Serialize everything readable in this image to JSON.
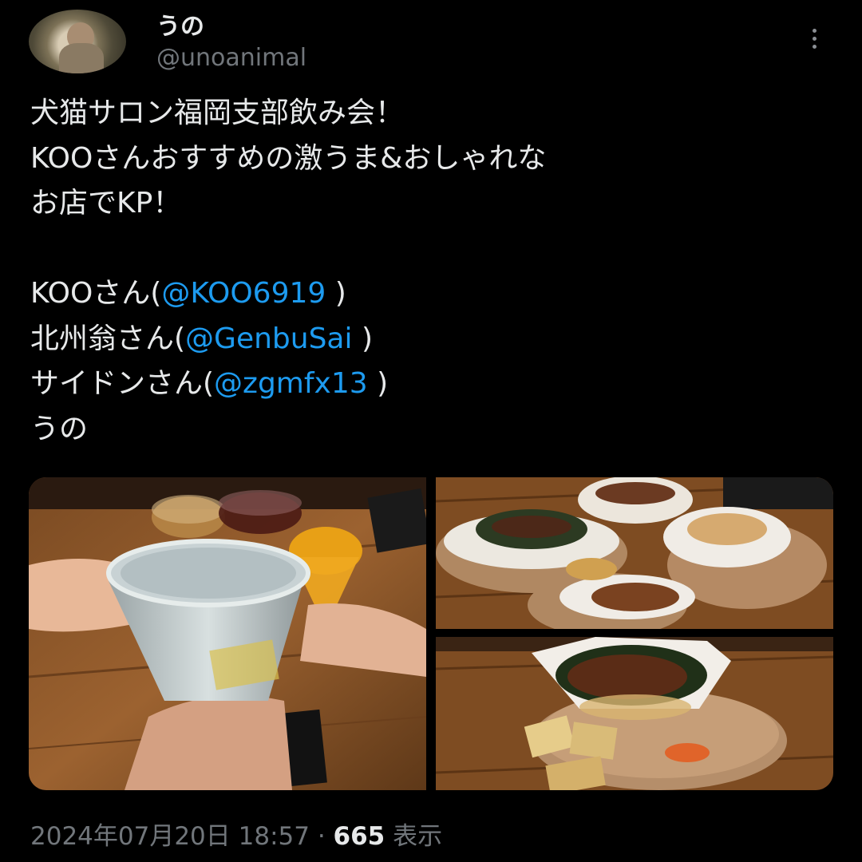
{
  "author": {
    "display_name": "うの",
    "handle": "@unoanimal",
    "avatar_icon": "monkey-avatar"
  },
  "menu": {
    "icon": "more-vertical-icon"
  },
  "tweet": {
    "lines": [
      [
        {
          "t": "犬猫サロン福岡支部飲み会！"
        }
      ],
      [
        {
          "t": "KOOさんおすすめの激うま&おしゃれな"
        }
      ],
      [
        {
          "t": "お店でKP！"
        }
      ],
      [
        {
          "t": ""
        }
      ],
      [
        {
          "t": "KOOさん("
        },
        {
          "t": "@KOO6919",
          "mention": true
        },
        {
          "t": " )"
        }
      ],
      [
        {
          "t": "北州翁さん("
        },
        {
          "t": "@GenbuSai",
          "mention": true
        },
        {
          "t": " )"
        }
      ],
      [
        {
          "t": "サイドンさん("
        },
        {
          "t": "@zgmfx13",
          "mention": true
        },
        {
          "t": " )"
        }
      ],
      [
        {
          "t": "うの"
        }
      ]
    ]
  },
  "footer": {
    "date": "2024年07月20日 18:57",
    "separator": " · ",
    "views_count": "665",
    "views_label": " 表示"
  },
  "colors": {
    "background": "#000000",
    "text": "#e7e9ea",
    "muted": "#71767b",
    "link": "#1d9bf0"
  }
}
